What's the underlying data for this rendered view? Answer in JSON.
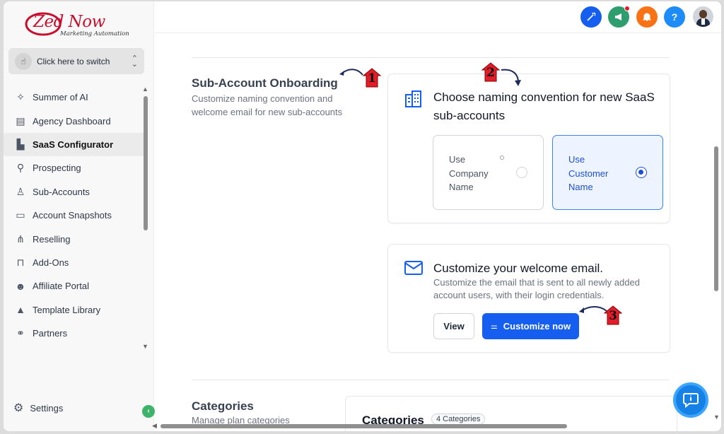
{
  "brand": {
    "logo_main": "Zed Now",
    "logo_sub": "Marketing Automation"
  },
  "switcher": {
    "label": "Click here to switch"
  },
  "sidebar": {
    "items": [
      {
        "label": "Summer of AI",
        "icon": "sparkle-icon"
      },
      {
        "label": "Agency Dashboard",
        "icon": "dashboard-icon"
      },
      {
        "label": "SaaS Configurator",
        "icon": "chart-icon",
        "active": true
      },
      {
        "label": "Prospecting",
        "icon": "person-search-icon"
      },
      {
        "label": "Sub-Accounts",
        "icon": "user-icon"
      },
      {
        "label": "Account Snapshots",
        "icon": "snapshot-icon"
      },
      {
        "label": "Reselling",
        "icon": "tree-icon"
      },
      {
        "label": "Add-Ons",
        "icon": "bag-icon"
      },
      {
        "label": "Affiliate Portal",
        "icon": "users-icon"
      },
      {
        "label": "Template Library",
        "icon": "shapes-icon"
      },
      {
        "label": "Partners",
        "icon": "handshake-icon"
      }
    ],
    "settings_label": "Settings",
    "collapse_glyph": "‹"
  },
  "topbar": {
    "help_glyph": "?"
  },
  "onboarding": {
    "title": "Sub-Account Onboarding",
    "description": "Customize naming convention and welcome email for new sub-accounts"
  },
  "naming_card": {
    "title": "Choose naming convention for new SaaS sub-accounts",
    "options": [
      {
        "label_line1": "Use",
        "label_line2": "Company",
        "label_line3": "Name",
        "selected": false
      },
      {
        "label_line1": "Use",
        "label_line2": "Customer",
        "label_line3": "Name",
        "selected": true
      }
    ]
  },
  "email_card": {
    "title": "Customize your welcome email.",
    "description": "Customize the email that is sent to all newly added account users, with their login credentials.",
    "view_label": "View",
    "customize_label": "Customize now"
  },
  "categories": {
    "title": "Categories",
    "description": "Manage plan categories",
    "card_title": "Categories",
    "badge": "4 Categories"
  },
  "annotations": {
    "m1": "1",
    "m2": "2",
    "m3": "3"
  },
  "colors": {
    "accent": "#155eef",
    "marker": "#e11d2a",
    "active_bg": "#eef4ff"
  }
}
